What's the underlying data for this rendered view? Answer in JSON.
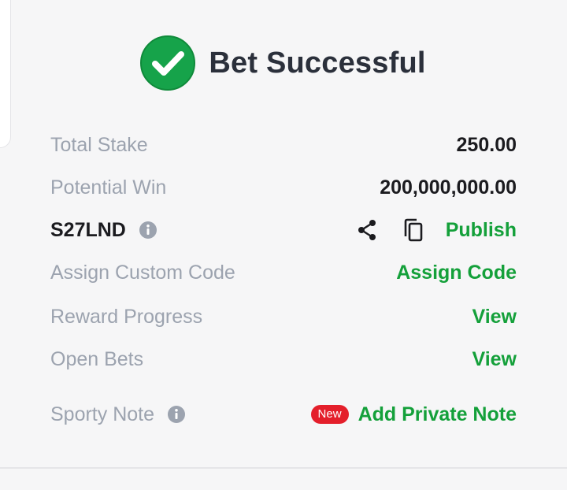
{
  "header": {
    "title": "Bet Successful",
    "icon": "check-circle-icon",
    "accent": "#14a03a"
  },
  "rows": {
    "total_stake": {
      "label": "Total Stake",
      "value": "250.00"
    },
    "potential_win": {
      "label": "Potential Win",
      "value": "200,000,000.00"
    },
    "booking": {
      "code": "S27LND",
      "info_icon": "info-icon",
      "share_icon": "share-icon",
      "copy_icon": "copy-icon",
      "publish_label": "Publish"
    },
    "custom_code": {
      "label": "Assign Custom Code",
      "link": "Assign Code"
    },
    "reward_progress": {
      "label": "Reward Progress",
      "link": "View"
    },
    "open_bets": {
      "label": "Open Bets",
      "link": "View"
    },
    "sporty_note": {
      "label": "Sporty Note",
      "badge": "New",
      "link": "Add Private Note"
    }
  },
  "colors": {
    "link_green": "#14a03a",
    "label_gray": "#9ca3af",
    "badge_red": "#e41f2b",
    "background": "#f6f6f7"
  }
}
